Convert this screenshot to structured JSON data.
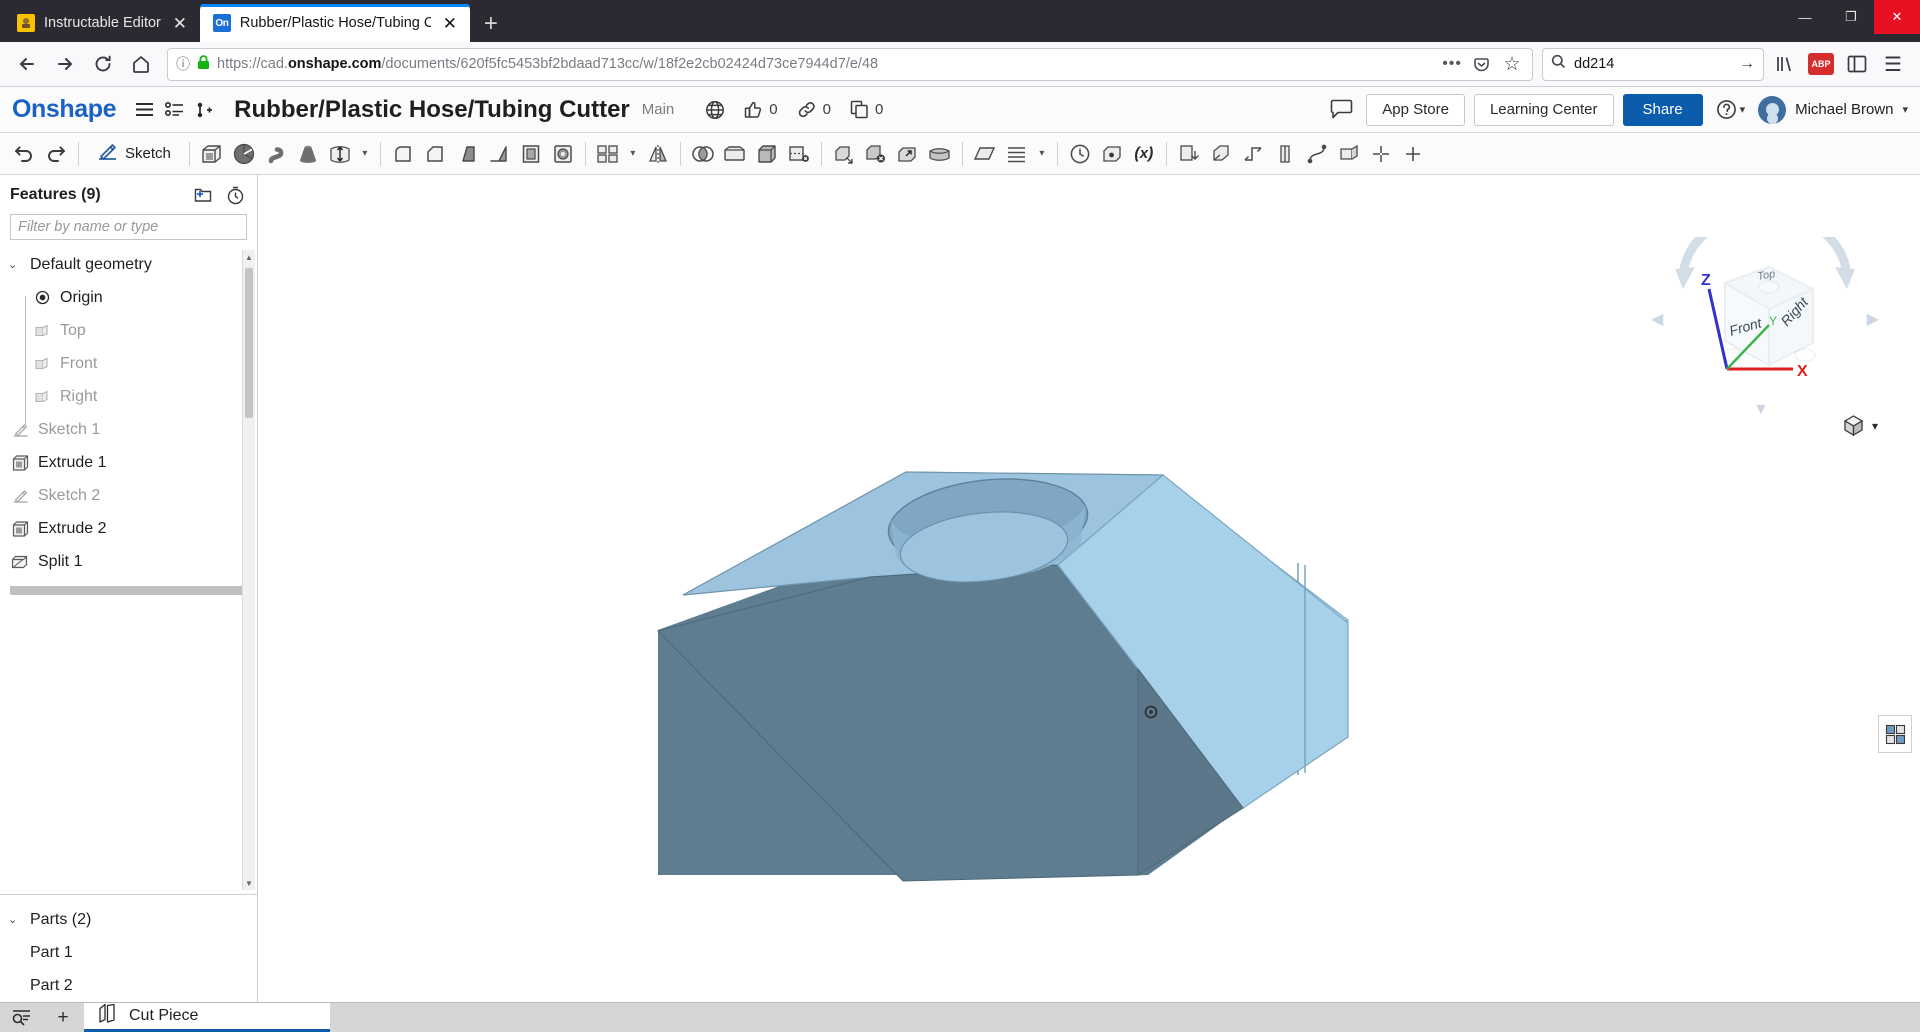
{
  "browser": {
    "tabs": [
      {
        "title": "Instructable Editor",
        "favicon": "instructable-icon",
        "active": false,
        "close_label": "✕"
      },
      {
        "title": "Rubber/Plastic Hose/Tubing Cu",
        "favicon": "onshape-icon",
        "favicon_text": "On",
        "active": true,
        "close_label": "✕"
      }
    ],
    "newtab_label": "+",
    "window_controls": {
      "minimize": "—",
      "maximize": "❐",
      "close": "✕"
    },
    "nav": {
      "back": "←",
      "forward": "→",
      "reload": "↻",
      "home": "⌂"
    },
    "url": {
      "scheme": "https://cad.",
      "domain": "onshape.com",
      "path": "/documents/620f5fc5453bf2bdaad713cc/w/18f2e2cb02424d73ce7944d7/e/48",
      "full": "https://cad.onshape.com/documents/620f5fc5453bf2bdaad713cc/w/18f2e2cb02424d73ce7944d7/e/48",
      "info_icon": "ⓘ",
      "lock_icon": "🔒",
      "page_actions": "•••",
      "pocket_icon": "pocket-icon",
      "bookmark_icon": "☆"
    },
    "search": {
      "value": "dd214",
      "icon": "🔍",
      "go": "→"
    },
    "toolbar_right": {
      "library": "library-icon",
      "adblock": "ABP",
      "sidebar": "sidebar-icon",
      "menu": "☰"
    }
  },
  "onshape": {
    "logo": "Onshape",
    "document_title": "Rubber/Plastic Hose/Tubing Cutter",
    "branch": "Main",
    "header_icons": {
      "menu": "☰",
      "tree": "tree-icon",
      "insert": "insert-icon"
    },
    "stats": [
      {
        "name": "public-globe",
        "icon": "🌐",
        "count": ""
      },
      {
        "name": "likes",
        "icon": "👍",
        "count": "0"
      },
      {
        "name": "links",
        "icon": "🔗",
        "count": "0"
      },
      {
        "name": "copies",
        "icon": "⧉",
        "count": "0"
      }
    ],
    "comment_icon": "💬",
    "app_store": "App Store",
    "learning_center": "Learning Center",
    "share": "Share",
    "help": "?",
    "user": "Michael Brown",
    "caret": "▾"
  },
  "toolbar": {
    "undo": "↶",
    "redo": "↷",
    "sketch": "Sketch",
    "tools": [
      "extrude-icon",
      "revolve-icon",
      "sweep-icon",
      "loft-icon",
      "thicken-icon",
      "fillet-icon",
      "chamfer-icon",
      "draft-icon",
      "rib-icon",
      "shell-icon",
      "hole-icon",
      "linear-pattern-icon",
      "mirror-icon",
      "boolean-icon",
      "enclose-icon",
      "split-icon",
      "transform-icon",
      "delete-face-icon",
      "move-face-icon",
      "replace-face-icon",
      "plane-icon",
      "sketch-plane-icon",
      "curve-icon",
      "measure-icon",
      "mass-props-icon",
      "variable-icon",
      "import-icon",
      "derive-icon",
      "assembly-icon",
      "configure-icon",
      "sheetmetal-icon",
      "weld-icon",
      "surface-icon",
      "add-custom-icon"
    ]
  },
  "sidebar": {
    "features_title": "Features (9)",
    "add_folder_icon": "add-folder-icon",
    "history_icon": "history-icon",
    "filter_placeholder": "Filter by name or type",
    "tree": [
      {
        "label": "Default geometry",
        "icon": "folder-icon",
        "expanded": true,
        "dim": false,
        "child": false,
        "caret": "⌄"
      },
      {
        "label": "Origin",
        "icon": "origin-icon",
        "dim": false,
        "child": true
      },
      {
        "label": "Top",
        "icon": "plane-icon",
        "dim": true,
        "child": true
      },
      {
        "label": "Front",
        "icon": "plane-icon",
        "dim": true,
        "child": true
      },
      {
        "label": "Right",
        "icon": "plane-icon",
        "dim": true,
        "child": true
      },
      {
        "label": "Sketch 1",
        "icon": "sketch-icon",
        "dim": true,
        "child": false
      },
      {
        "label": "Extrude 1",
        "icon": "extrude-icon",
        "dim": false,
        "child": false
      },
      {
        "label": "Sketch 2",
        "icon": "sketch-icon",
        "dim": true,
        "child": false
      },
      {
        "label": "Extrude 2",
        "icon": "extrude-icon",
        "dim": false,
        "child": false
      },
      {
        "label": "Split 1",
        "icon": "split-icon",
        "dim": false,
        "child": false
      }
    ],
    "parts_title": "Parts (2)",
    "parts_caret": "⌄",
    "parts": [
      {
        "label": "Part 1"
      },
      {
        "label": "Part 2"
      }
    ]
  },
  "viewport": {
    "viewcube": {
      "faces": {
        "top": "Top",
        "front": "Front",
        "right": "Right"
      },
      "axes": {
        "x": "X",
        "y": "Y",
        "z": "Z"
      },
      "axis_colors": {
        "x": "#e02020",
        "y": "#3ab54a",
        "z": "#3333cc"
      },
      "arrows": {
        "left": "◀",
        "right": "▶",
        "down": "▼"
      }
    },
    "view_toggle_caret": "▾",
    "display_icon": "display-mode-icon",
    "model": {
      "name": "tubing-cutter-model",
      "colors": {
        "front_dark": "#5c7a8c",
        "top_light": "#9dc5de",
        "side_light": "#a8cfe6",
        "hole_inner": "#7fa8c4"
      }
    }
  },
  "bottom": {
    "filter_icon": "filter-icon",
    "add_icon": "+",
    "tabs": [
      {
        "label": "Cut Piece",
        "icon": "part-studio-icon",
        "active": true
      }
    ]
  }
}
